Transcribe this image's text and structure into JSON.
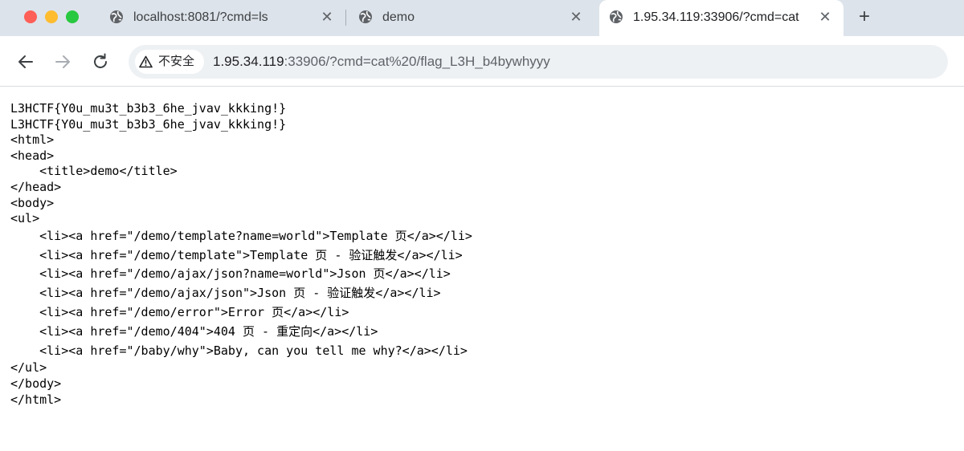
{
  "tabs": [
    {
      "title": "localhost:8081/?cmd=ls",
      "active": false
    },
    {
      "title": "demo",
      "active": false
    },
    {
      "title": "1.95.34.119:33906/?cmd=cat",
      "active": true
    }
  ],
  "toolbar": {
    "security_label": "不安全",
    "url_host": "1.95.34.119",
    "url_rest": ":33906/?cmd=cat%20/flag_L3H_b4bywhyyy"
  },
  "page": {
    "lines_top": [
      "L3HCTF{Y0u_mu3t_b3b3_6he_jvav_kkking!}",
      "L3HCTF{Y0u_mu3t_b3b3_6he_jvav_kkking!}",
      "<html>",
      "<head>",
      "    <title>demo</title>",
      "</head>",
      "<body>",
      "<ul>"
    ],
    "lines_list": [
      "    <li><a href=\"/demo/template?name=world\">Template 页</a></li>",
      "    <li><a href=\"/demo/template\">Template 页 - 验证触发</a></li>",
      "    <li><a href=\"/demo/ajax/json?name=world\">Json 页</a></li>",
      "    <li><a href=\"/demo/ajax/json\">Json 页 - 验证触发</a></li>",
      "    <li><a href=\"/demo/error\">Error 页</a></li>",
      "    <li><a href=\"/demo/404\">404 页 - 重定向</a></li>",
      "    <li><a href=\"/baby/why\">Baby, can you tell me why?</a></li>"
    ],
    "lines_bottom": [
      "</ul>",
      "</body>",
      "</html>"
    ]
  },
  "colors": {
    "tabstrip": "#dde3ea",
    "omnibox": "#eef1f4",
    "close_red": "#fe5f57",
    "minimize_yellow": "#febc2e",
    "zoom_green": "#28c840"
  },
  "icons": [
    "globe-icon",
    "close-icon",
    "plus-icon",
    "back-arrow-icon",
    "forward-arrow-icon",
    "reload-icon",
    "warning-triangle-icon"
  ]
}
